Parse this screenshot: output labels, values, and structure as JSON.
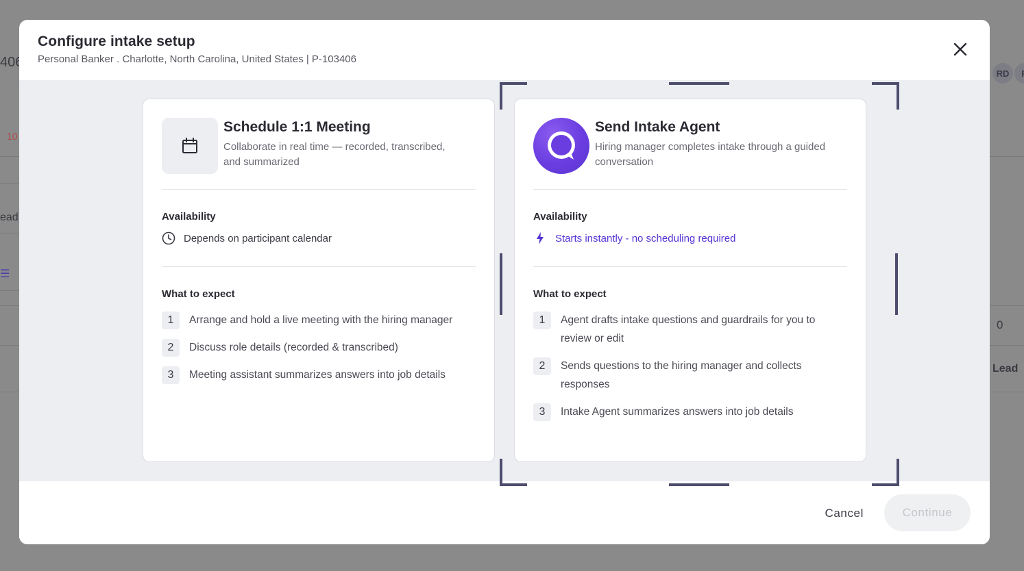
{
  "background": {
    "left_frag_1": "406",
    "left_frag_2": "10",
    "left_frag_3": "ead",
    "right_badge_1": "RD",
    "right_badge_2": "R",
    "right_frag_1": "0",
    "right_frag_2": "Lead"
  },
  "modal": {
    "title": "Configure intake setup",
    "subtitle": "Personal Banker . Charlotte, North Carolina, United States | P-103406"
  },
  "icons": {
    "close": "close-icon",
    "calendar": "calendar-icon",
    "clock": "clock-icon",
    "bolt": "bolt-icon",
    "agent": "chat-bubble-icon"
  },
  "colors": {
    "accent": "#5533d4",
    "agent_logo": "#6a3de0",
    "bracket": "#4e4d6e"
  },
  "cards": [
    {
      "title": "Schedule 1:1 Meeting",
      "description": "Collaborate in real time — recorded, transcribed, and summarized",
      "availability_label": "Availability",
      "availability_text": "Depends on participant calendar",
      "expect_label": "What to expect",
      "steps": [
        {
          "num": "1",
          "text": "Arrange and hold a live meeting with the hiring manager"
        },
        {
          "num": "2",
          "text": "Discuss role details (recorded & transcribed)"
        },
        {
          "num": "3",
          "text": "Meeting assistant summarizes answers into job details"
        }
      ]
    },
    {
      "title": "Send Intake Agent",
      "description": "Hiring manager completes intake through a guided conversation",
      "availability_label": "Availability",
      "availability_text": "Starts instantly - no scheduling required",
      "expect_label": "What to expect",
      "steps": [
        {
          "num": "1",
          "text": "Agent drafts intake questions and guardrails for you to review or edit"
        },
        {
          "num": "2",
          "text": "Sends questions to the hiring manager and collects responses"
        },
        {
          "num": "3",
          "text": "Intake Agent summarizes answers into job details"
        }
      ]
    }
  ],
  "footer": {
    "cancel_label": "Cancel",
    "continue_label": "Continue"
  }
}
